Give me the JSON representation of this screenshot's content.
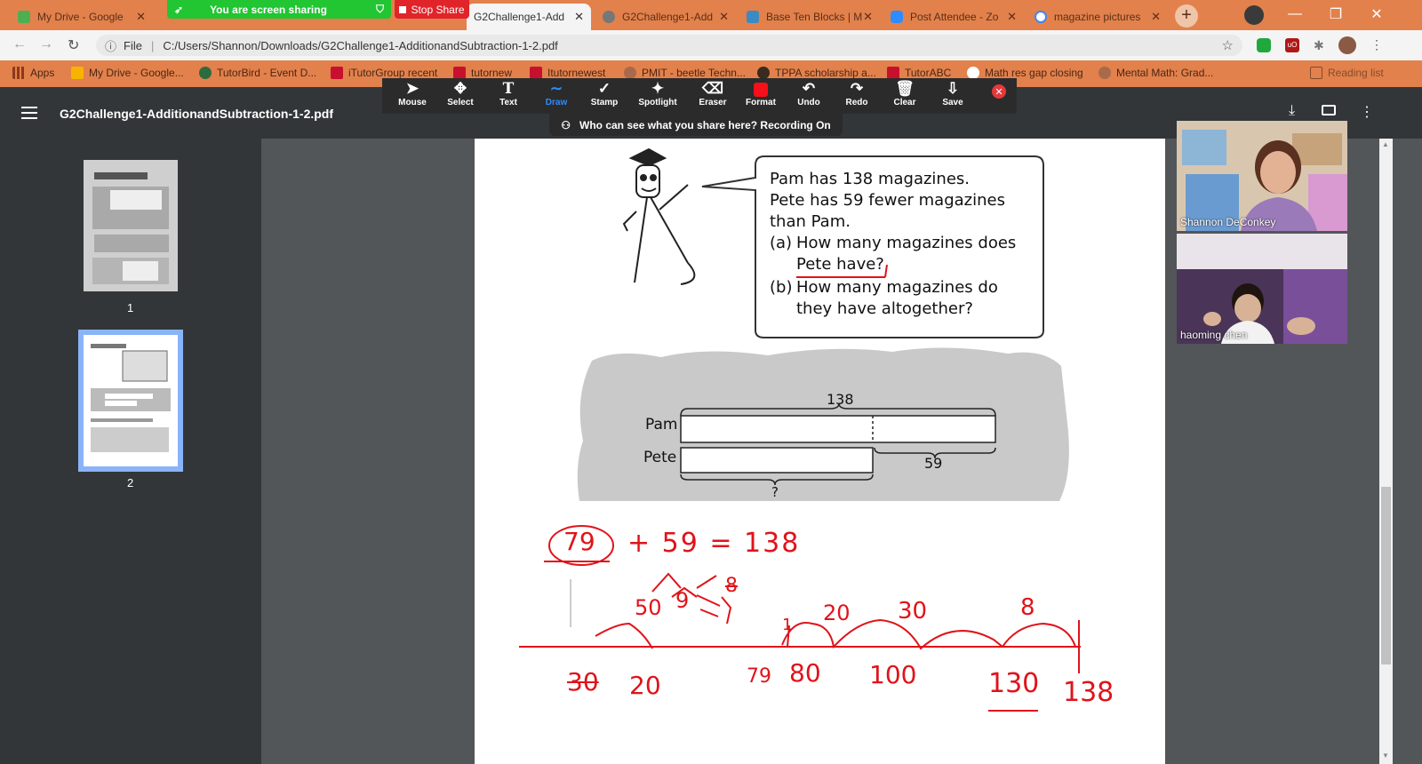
{
  "tabs": [
    {
      "title": "My Drive - Google",
      "color": "#4caf50"
    },
    {
      "title": "G2Challenge1-Add",
      "color": "#c00000"
    },
    {
      "title": "G2Challenge1-Add",
      "color": "#777777"
    },
    {
      "title": "Base Ten Blocks | M",
      "color": "#3b8ac4"
    },
    {
      "title": "Post Attendee - Zo",
      "color": "#2d8cff"
    },
    {
      "title": "magazine pictures",
      "color": "#4285f4"
    }
  ],
  "share": {
    "sharing_label": "You are screen sharing",
    "stop_label": "Stop Share"
  },
  "address": {
    "scheme_label": "File",
    "url": "C:/Users/Shannon/Downloads/G2Challenge1-AdditionandSubtraction-1-2.pdf"
  },
  "bookmarks": [
    {
      "label": "Apps"
    },
    {
      "label": "My Drive - Google..."
    },
    {
      "label": "TutorBird - Event D..."
    },
    {
      "label": "iTutorGroup recent"
    },
    {
      "label": "tutornew"
    },
    {
      "label": "Itutornewest"
    },
    {
      "label": "PMIT - beetle Techn..."
    },
    {
      "label": "TPPA scholarship a..."
    },
    {
      "label": "TutorABC"
    },
    {
      "label": "Math res gap closing"
    },
    {
      "label": "Mental Math: Grad..."
    },
    {
      "label": "Reading list"
    }
  ],
  "pdf": {
    "title": "G2Challenge1-AdditionandSubtraction-1-2.pdf",
    "pages": [
      "1",
      "2"
    ],
    "problem": {
      "line1": "Pam has 138 magazines.",
      "line2": "Pete has 59 fewer magazines",
      "line3": "than Pam.",
      "qa_label": "(a)",
      "qa1": "How many magazines does",
      "qa2": "Pete have?",
      "qb_label": "(b)",
      "qb1": "How many magazines do",
      "qb2": "they have altogether?"
    },
    "bar_model": {
      "total": "138",
      "row1": "Pam",
      "row2": "Pete",
      "difference": "59",
      "unknown": "?"
    },
    "handwriting": {
      "equation": "+ 59 = 138",
      "answer": "79",
      "split_a": "50",
      "split_b": "9",
      "split_c": "8",
      "split_d": "1",
      "jump_1": "1",
      "jump_20": "20",
      "jump_30": "30",
      "jump_8": "8",
      "nl_30": "30",
      "nl_20": "20",
      "nl_79": "79",
      "nl_80": "80",
      "nl_100": "100",
      "nl_130": "130",
      "nl_138": "138"
    }
  },
  "zoom_toolbar": {
    "tools": [
      "Mouse",
      "Select",
      "Text",
      "Draw",
      "Stamp",
      "Spotlight",
      "Eraser",
      "Format",
      "Undo",
      "Redo",
      "Clear",
      "Save"
    ],
    "selected": "Draw",
    "notice": "Who can see what you share here? Recording On"
  },
  "participants": [
    {
      "name": "Shannon DeConkey"
    },
    {
      "name": "haoming   chen"
    }
  ],
  "colors": {
    "chrome": "#e2814c",
    "pdf_dark": "#323639",
    "ink": "#e0131a",
    "share_green": "#22c532",
    "stop_red": "#e0242a",
    "zoom_blue": "#2d8cff"
  }
}
